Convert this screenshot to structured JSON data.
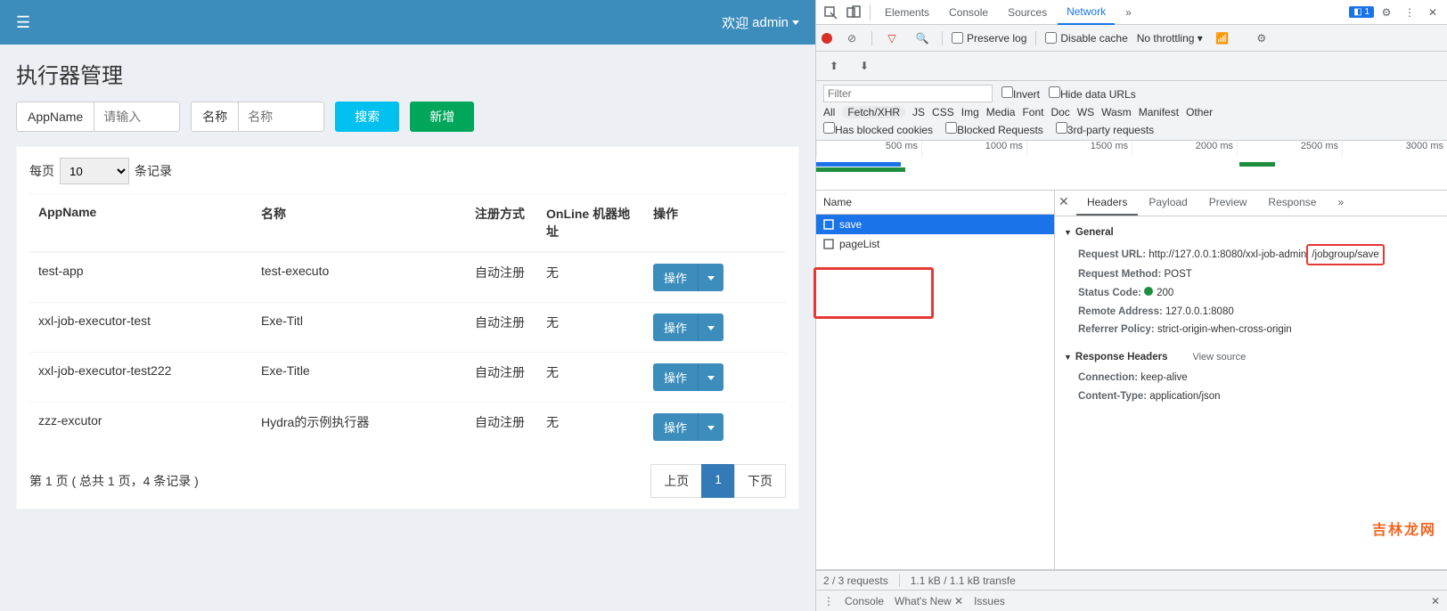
{
  "topbar": {
    "welcome_prefix": "欢迎",
    "user": "admin"
  },
  "page": {
    "title": "执行器管理"
  },
  "search": {
    "appname_label": "AppName",
    "appname_placeholder": "请输入",
    "name_label": "名称",
    "name_placeholder": "名称",
    "search_btn": "搜索",
    "add_btn": "新增"
  },
  "page_size": {
    "prefix": "每页",
    "value": "10",
    "suffix": "条记录"
  },
  "table": {
    "headers": [
      "AppName",
      "名称",
      "注册方式",
      "OnLine 机器地址",
      "操作"
    ],
    "action_label": "操作",
    "rows": [
      {
        "app": "test-app",
        "name": "test-executo",
        "reg": "自动注册",
        "online": "无"
      },
      {
        "app": "xxl-job-executor-test",
        "name": "Exe-Titl",
        "reg": "自动注册",
        "online": "无"
      },
      {
        "app": "xxl-job-executor-test222",
        "name": "Exe-Title",
        "reg": "自动注册",
        "online": "无"
      },
      {
        "app": "zzz-excutor",
        "name": "Hydra的示例执行器",
        "reg": "自动注册",
        "online": "无"
      }
    ]
  },
  "footer": {
    "info": "第 1 页 ( 总共 1 页，4 条记录 )",
    "prev": "上页",
    "current": "1",
    "next": "下页"
  },
  "devtools": {
    "tabs": [
      "Elements",
      "Console",
      "Sources",
      "Network"
    ],
    "warn_count": "1",
    "toolbar": {
      "preserve": "Preserve log",
      "disable_cache": "Disable cache",
      "throttle": "No throttling"
    },
    "updown": {
      "up": "↑",
      "down": "↓"
    },
    "filter": {
      "placeholder": "Filter",
      "invert": "Invert",
      "hide_urls": "Hide data URLs"
    },
    "types": [
      "All",
      "Fetch/XHR",
      "JS",
      "CSS",
      "Img",
      "Media",
      "Font",
      "Doc",
      "WS",
      "Wasm",
      "Manifest",
      "Other"
    ],
    "extra_ck": [
      "Has blocked cookies",
      "Blocked Requests",
      "3rd-party requests"
    ],
    "ticks": [
      "500 ms",
      "1000 ms",
      "1500 ms",
      "2000 ms",
      "2500 ms",
      "3000 ms"
    ],
    "req_header": "Name",
    "requests": [
      {
        "name": "save",
        "selected": true
      },
      {
        "name": "pageList",
        "selected": false
      }
    ],
    "detail_tabs": [
      "Headers",
      "Payload",
      "Preview",
      "Response"
    ],
    "general": {
      "title": "General",
      "url_label": "Request URL:",
      "url_pre": "http://127.0.0.1:8080/xxl-job-admin",
      "url_highlight": "/jobgroup/save",
      "method_label": "Request Method:",
      "method": "POST",
      "status_label": "Status Code:",
      "status": "200",
      "remote_label": "Remote Address:",
      "remote": "127.0.0.1:8080",
      "referrer_label": "Referrer Policy:",
      "referrer": "strict-origin-when-cross-origin"
    },
    "resp_headers": {
      "title": "Response Headers",
      "view_src": "View source",
      "conn_label": "Connection:",
      "conn": "keep-alive",
      "ct_label": "Content-Type:",
      "ct": "application/json"
    },
    "status_bar": {
      "reqs": "2 / 3 requests",
      "size": "1.1 kB / 1.1 kB transfe"
    },
    "drawer": [
      "Console",
      "What's New",
      "Issues"
    ],
    "watermark": "吉林龙网"
  }
}
